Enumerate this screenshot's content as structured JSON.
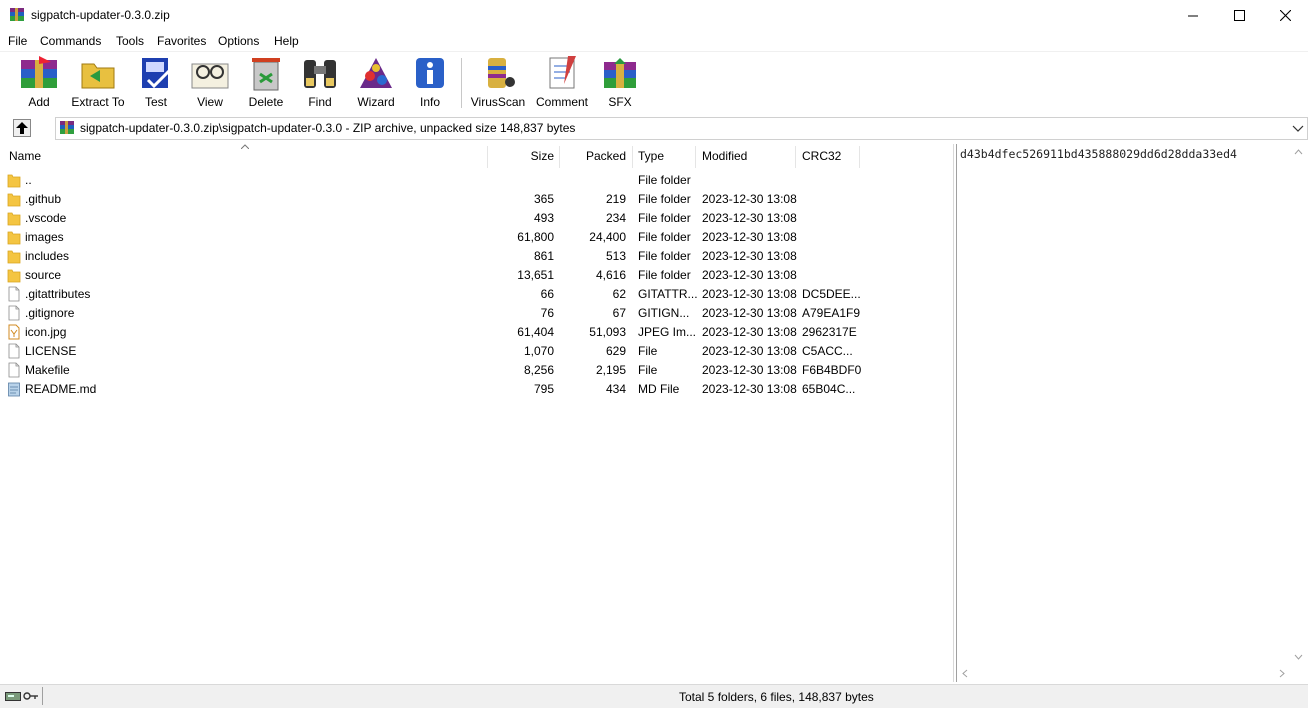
{
  "window": {
    "title": "sigpatch-updater-0.3.0.zip"
  },
  "menu": [
    "File",
    "Commands",
    "Tools",
    "Favorites",
    "Options",
    "Help"
  ],
  "toolbar": {
    "add": "Add",
    "extract": "Extract To",
    "test": "Test",
    "view": "View",
    "delete": "Delete",
    "find": "Find",
    "wizard": "Wizard",
    "info": "Info",
    "virusscan": "VirusScan",
    "comment": "Comment",
    "sfx": "SFX"
  },
  "path": {
    "text": "sigpatch-updater-0.3.0.zip\\sigpatch-updater-0.3.0 - ZIP archive, unpacked size 148,837 bytes"
  },
  "columns": {
    "name": "Name",
    "size": "Size",
    "packed": "Packed",
    "type": "Type",
    "modified": "Modified",
    "crc": "CRC32"
  },
  "files": [
    {
      "name": "..",
      "size": "",
      "packed": "",
      "type": "File folder",
      "modified": "",
      "crc": "",
      "icon": "folder-icon"
    },
    {
      "name": ".github",
      "size": "365",
      "packed": "219",
      "type": "File folder",
      "modified": "2023-12-30 13:08",
      "crc": "",
      "icon": "folder-icon"
    },
    {
      "name": ".vscode",
      "size": "493",
      "packed": "234",
      "type": "File folder",
      "modified": "2023-12-30 13:08",
      "crc": "",
      "icon": "folder-icon"
    },
    {
      "name": "images",
      "size": "61,800",
      "packed": "24,400",
      "type": "File folder",
      "modified": "2023-12-30 13:08",
      "crc": "",
      "icon": "folder-icon"
    },
    {
      "name": "includes",
      "size": "861",
      "packed": "513",
      "type": "File folder",
      "modified": "2023-12-30 13:08",
      "crc": "",
      "icon": "folder-icon"
    },
    {
      "name": "source",
      "size": "13,651",
      "packed": "4,616",
      "type": "File folder",
      "modified": "2023-12-30 13:08",
      "crc": "",
      "icon": "folder-icon"
    },
    {
      "name": ".gitattributes",
      "size": "66",
      "packed": "62",
      "type": "GITATTR...",
      "modified": "2023-12-30 13:08",
      "crc": "DC5DEE...",
      "icon": "file-icon"
    },
    {
      "name": ".gitignore",
      "size": "76",
      "packed": "67",
      "type": "GITIGN...",
      "modified": "2023-12-30 13:08",
      "crc": "A79EA1F9",
      "icon": "file-icon"
    },
    {
      "name": "icon.jpg",
      "size": "61,404",
      "packed": "51,093",
      "type": "JPEG Im...",
      "modified": "2023-12-30 13:08",
      "crc": "2962317E",
      "icon": "image-file-icon"
    },
    {
      "name": "LICENSE",
      "size": "1,070",
      "packed": "629",
      "type": "File",
      "modified": "2023-12-30 13:08",
      "crc": "C5ACC...",
      "icon": "file-icon"
    },
    {
      "name": "Makefile",
      "size": "8,256",
      "packed": "2,195",
      "type": "File",
      "modified": "2023-12-30 13:08",
      "crc": "F6B4BDF0",
      "icon": "file-icon"
    },
    {
      "name": "README.md",
      "size": "795",
      "packed": "434",
      "type": "MD File",
      "modified": "2023-12-30 13:08",
      "crc": "65B04C...",
      "icon": "md-file-icon"
    }
  ],
  "comment": {
    "text": "d43b4dfec526911bd435888029dd6d28dda33ed4"
  },
  "status": {
    "text": "Total 5 folders, 6 files, 148,837 bytes"
  }
}
